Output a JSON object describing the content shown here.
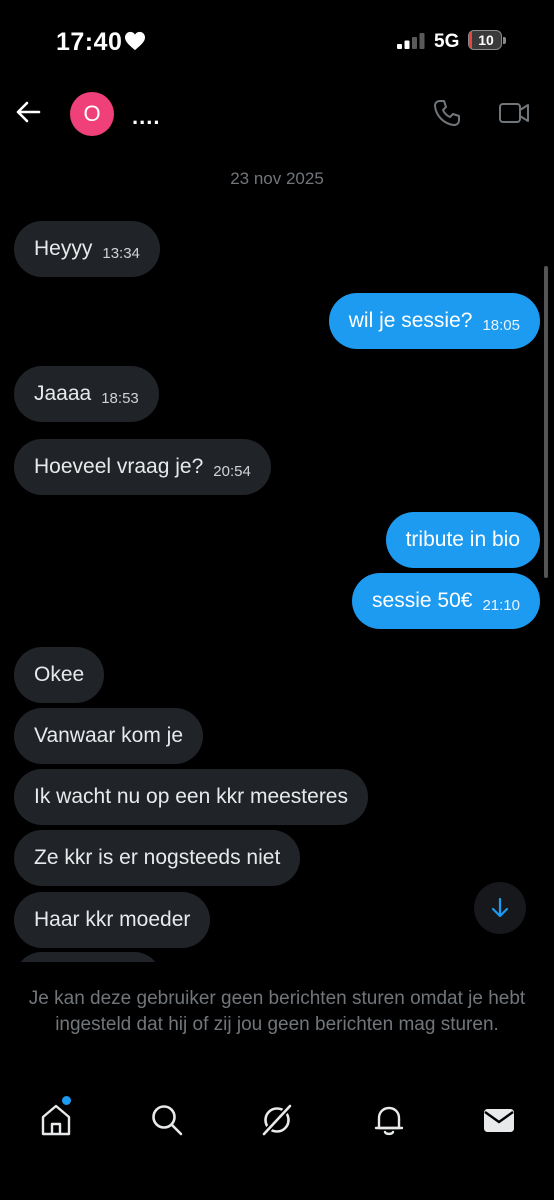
{
  "status_bar": {
    "time": "17:40",
    "network": "5G",
    "battery": "10",
    "battery_level": 0.1,
    "heart_icon": "heart-icon",
    "signal_icon": "signal-icon"
  },
  "header": {
    "avatar_letter": "O",
    "contact_name": "....",
    "back_icon": "arrow-left-icon",
    "call_icon": "phone-icon",
    "video_icon": "video-camera-icon"
  },
  "conversation": {
    "date": "23 nov 2025",
    "messages": [
      {
        "direction": "in",
        "text": "Heyyy",
        "time": "13:34"
      },
      {
        "direction": "out",
        "text": "wil je sessie?",
        "time": "18:05"
      },
      {
        "direction": "in",
        "text": "Jaaaa",
        "time": "18:53"
      },
      {
        "direction": "in",
        "text": "Hoeveel vraag je?",
        "time": "20:54"
      },
      {
        "direction": "out",
        "text": "tribute in bio",
        "time": ""
      },
      {
        "direction": "out",
        "text": "sessie 50€",
        "time": "21:10"
      },
      {
        "direction": "in",
        "text": "Okee",
        "time": ""
      },
      {
        "direction": "in",
        "text": "Vanwaar kom je",
        "time": ""
      },
      {
        "direction": "in",
        "text": "Ik wacht nu op een kkr meesteres",
        "time": ""
      },
      {
        "direction": "in",
        "text": "Ze kkr is er nogsteeds niet",
        "time": ""
      },
      {
        "direction": "in",
        "text": "Haar kkr moeder",
        "time": ""
      }
    ]
  },
  "notice": "Je kan deze gebruiker geen berichten sturen omdat je hebt ingesteld dat hij of zij jou geen berichten mag sturen.",
  "nav": {
    "items": [
      "home-icon",
      "search-icon",
      "grok-icon",
      "bell-icon",
      "mail-icon"
    ]
  },
  "colors": {
    "accent": "#1d9bf0",
    "incoming_bubble": "#202327",
    "muted_text": "#71767b",
    "avatar": "#f0407a"
  }
}
